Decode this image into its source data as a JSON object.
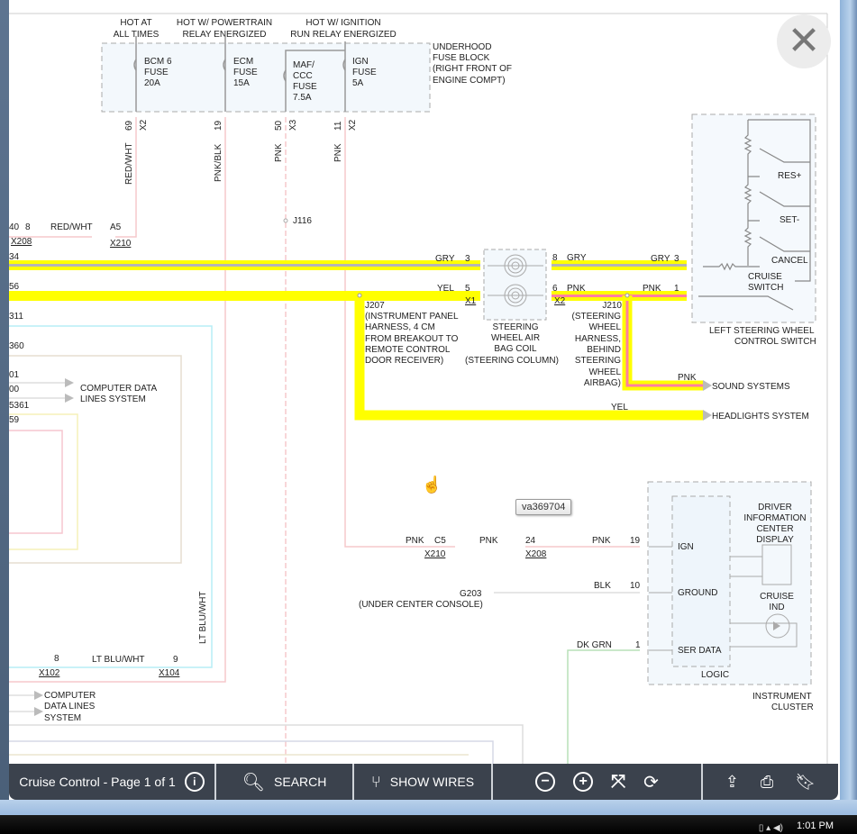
{
  "viewer": {
    "close_icon": "close-x-icon",
    "tooltip": "va369704"
  },
  "diagram": {
    "headers": {
      "hot_all_1": "HOT AT",
      "hot_all_2": "ALL TIMES",
      "hot_pt_1": "HOT W/ POWERTRAIN",
      "hot_pt_2": "RELAY ENERGIZED",
      "hot_ign_1": "HOT W/ IGNITION",
      "hot_ign_2": "RUN RELAY ENERGIZED"
    },
    "fuse_block": {
      "l1": "UNDERHOOD",
      "l2": "FUSE BLOCK",
      "l3": "(RIGHT FRONT OF",
      "l4": "ENGINE COMPT)",
      "fuses": [
        {
          "l1": "BCM 6",
          "l2": "FUSE",
          "l3": "20A"
        },
        {
          "l1": "ECM",
          "l2": "FUSE",
          "l3": "15A"
        },
        {
          "l1": "MAF/",
          "l2": "CCC",
          "l3": "FUSE",
          "l4": "7.5A"
        },
        {
          "l1": "IGN",
          "l2": "FUSE",
          "l3": "5A"
        }
      ],
      "pins": [
        {
          "pin": "69",
          "conn": "X2",
          "color": "RED/WHT"
        },
        {
          "pin": "19",
          "conn": "",
          "color": "PNK/BLK"
        },
        {
          "pin": "50",
          "conn": "X3",
          "color": "PNK"
        },
        {
          "pin": "11",
          "conn": "X2",
          "color": "PNK"
        }
      ]
    },
    "left_labels": {
      "r1a": "40",
      "r1b": "8",
      "r1c": "RED/WHT",
      "r1d": "A5",
      "r1e": "X208",
      "r1f": "X210",
      "r2": "34",
      "r3": "56",
      "r4": "311",
      "r5": "360",
      "r6": "01",
      "r7": "00",
      "r8": "5361",
      "r9": "59",
      "cdl1": "COMPUTER DATA",
      "cdl2": "LINES SYSTEM",
      "j116": "J116",
      "ltblu_v": "LT BLU/WHT",
      "ltblu_h": "LT BLU/WHT",
      "x102_pin": "8",
      "x102": "X102",
      "x104_pin": "9",
      "x104": "X104",
      "cdl_b1": "COMPUTER",
      "cdl_b2": "DATA LINES",
      "cdl_b3": "SYSTEM"
    },
    "harness": {
      "gry_l": "GRY",
      "gry_pin_l": "3",
      "yel_l": "YEL",
      "yel_pin_l": "5",
      "x1": "X1",
      "gry_r": "GRY",
      "gry_pin_r": "8",
      "pnk_r": "PNK",
      "pnk_pin_r": "6",
      "x2": "X2",
      "gry_sw": "GRY",
      "gry_sw_pin": "3",
      "pnk_sw": "PNK",
      "pnk_sw_pin": "1",
      "coil1": "STEERING",
      "coil2": "WHEEL AIR",
      "coil3": "BAG COIL",
      "coil4": "(STEERING COLUMN)",
      "j207": [
        "J207",
        "(INSTRUMENT PANEL",
        "HARNESS, 4 CM",
        "FROM BREAKOUT TO",
        "REMOTE CONTROL",
        "DOOR RECEIVER)"
      ],
      "j210": [
        "J210",
        "(STEERING",
        "WHEEL",
        "HARNESS,",
        "BEHIND",
        "STEERING",
        "WHEEL",
        "AIRBAG)"
      ],
      "pnk_sound": "PNK",
      "sound": "SOUND SYSTEMS",
      "yel_head": "YEL",
      "headlights": "HEADLIGHTS SYSTEM"
    },
    "switch": {
      "res": "RES+",
      "set": "SET-",
      "cancel": "CANCEL",
      "cruise1": "CRUISE",
      "cruise2": "SWITCH",
      "box1": "LEFT STEERING WHEEL",
      "box2": "CONTROL SWITCH"
    },
    "cluster": {
      "pnk1": "PNK",
      "c5": "C5",
      "x210": "X210",
      "pnk2": "PNK",
      "p24": "24",
      "x208": "X208",
      "pnk3": "PNK",
      "p19": "19",
      "ign": "IGN",
      "blk": "BLK",
      "p10": "10",
      "ground": "GROUND",
      "g203": "G203",
      "g203_loc": "(UNDER CENTER CONSOLE)",
      "dkgrn": "DK GRN",
      "p1": "1",
      "serdata": "SER DATA",
      "logic": "LOGIC",
      "dic1": "DRIVER",
      "dic2": "INFORMATION",
      "dic3": "CENTER",
      "dic4": "DISPLAY",
      "ind1": "CRUISE",
      "ind2": "IND",
      "ic1": "INSTRUMENT",
      "ic2": "CLUSTER"
    },
    "colors": {
      "yellow": "#ffff00",
      "gray_wire": "#b5b5b5",
      "pink_wire": "#ff7fa0",
      "light_pink": "#f6c9cc"
    }
  },
  "toolbar": {
    "title": "Cruise Control - Page 1 of 1",
    "info_icon": "info-icon",
    "search_label": "SEARCH",
    "show_wires_label": "SHOW WIRES",
    "icons": [
      "zoom-out-icon",
      "zoom-in-icon",
      "fit-icon",
      "rotate-icon",
      "share-icon",
      "print-icon",
      "bookmark-icon"
    ]
  },
  "taskbar": {
    "clock": "1:01 PM"
  }
}
